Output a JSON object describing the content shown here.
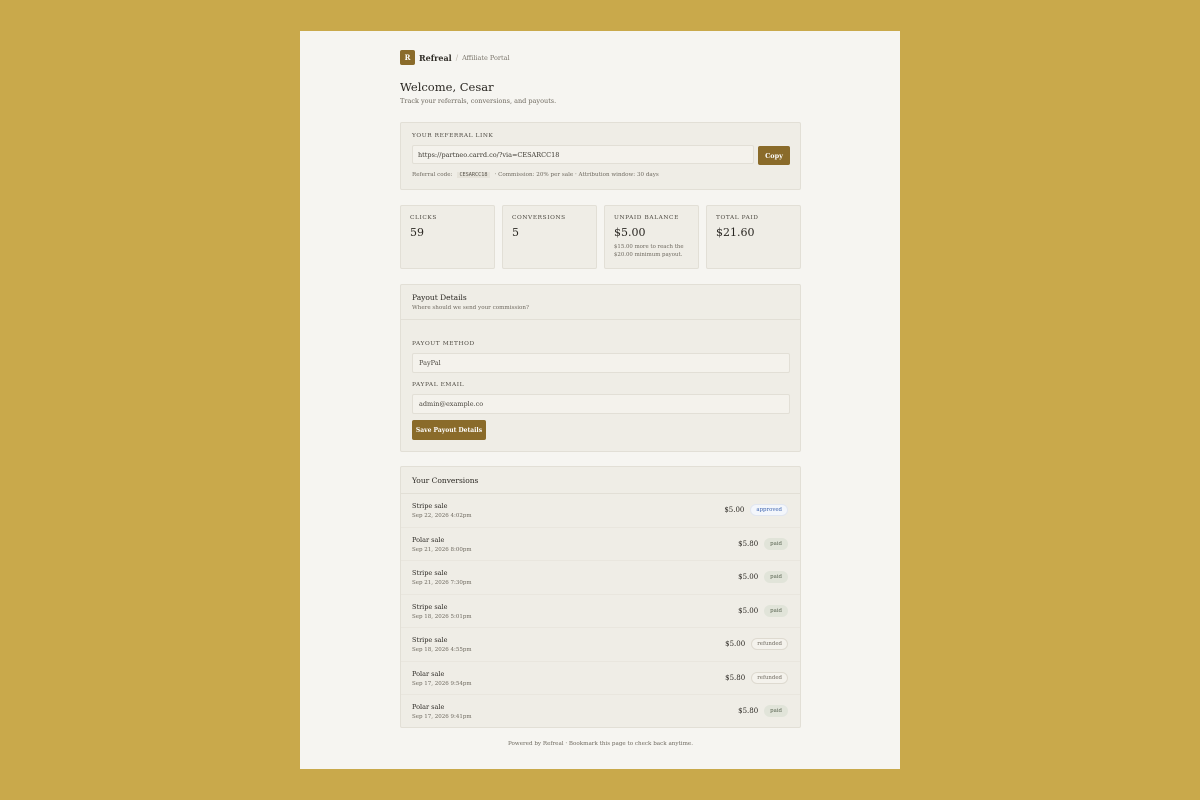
{
  "brand": {
    "mark": "R",
    "name": "Refreal",
    "separator": "/",
    "subtitle": "Affiliate Portal"
  },
  "welcome": {
    "title": "Welcome, Cesar",
    "tagline": "Track your referrals, conversions, and payouts."
  },
  "referral": {
    "label": "YOUR REFERRAL LINK",
    "link": "https://partneo.carrd.co/?via=CESARCC18",
    "copy_label": "Copy",
    "code_label": "Referral code:",
    "code": "CESARCC18",
    "commission": "· Commission: 20% per sale · Attribution window: 30 days"
  },
  "stats": [
    {
      "label": "CLICKS",
      "value": "59",
      "note": ""
    },
    {
      "label": "CONVERSIONS",
      "value": "5",
      "note": ""
    },
    {
      "label": "UNPAID BALANCE",
      "value": "$5.00",
      "note": "$15.00 more to reach the $20.00 minimum payout."
    },
    {
      "label": "TOTAL PAID",
      "value": "$21.60",
      "note": ""
    }
  ],
  "payout": {
    "title": "Payout Details",
    "subtitle": "Where should we send your commission?",
    "method_label": "PAYOUT METHOD",
    "method_value": "PayPal",
    "email_label": "PAYPAL EMAIL",
    "email_value": "admin@example.co",
    "save_label": "Save Payout Details"
  },
  "conversions": {
    "title": "Your Conversions",
    "rows": [
      {
        "title": "Stripe sale",
        "date": "Sep 22, 2026 4:02pm",
        "amount": "$5.00",
        "status": "approved"
      },
      {
        "title": "Polar sale",
        "date": "Sep 21, 2026 8:00pm",
        "amount": "$5.80",
        "status": "paid"
      },
      {
        "title": "Stripe sale",
        "date": "Sep 21, 2026 7:30pm",
        "amount": "$5.00",
        "status": "paid"
      },
      {
        "title": "Stripe sale",
        "date": "Sep 18, 2026 5:01pm",
        "amount": "$5.00",
        "status": "paid"
      },
      {
        "title": "Stripe sale",
        "date": "Sep 18, 2026 4:55pm",
        "amount": "$5.00",
        "status": "refunded"
      },
      {
        "title": "Polar sale",
        "date": "Sep 17, 2026 9:54pm",
        "amount": "$5.80",
        "status": "refunded"
      },
      {
        "title": "Polar sale",
        "date": "Sep 17, 2026 9:41pm",
        "amount": "$5.80",
        "status": "paid"
      }
    ]
  },
  "footer": {
    "text": "Powered by Refreal · Bookmark this page to check back anytime."
  },
  "colors": {
    "background": "#c9a94b",
    "page": "#f6f5f1",
    "accent": "#8a6b2a",
    "card": "#efede6"
  }
}
